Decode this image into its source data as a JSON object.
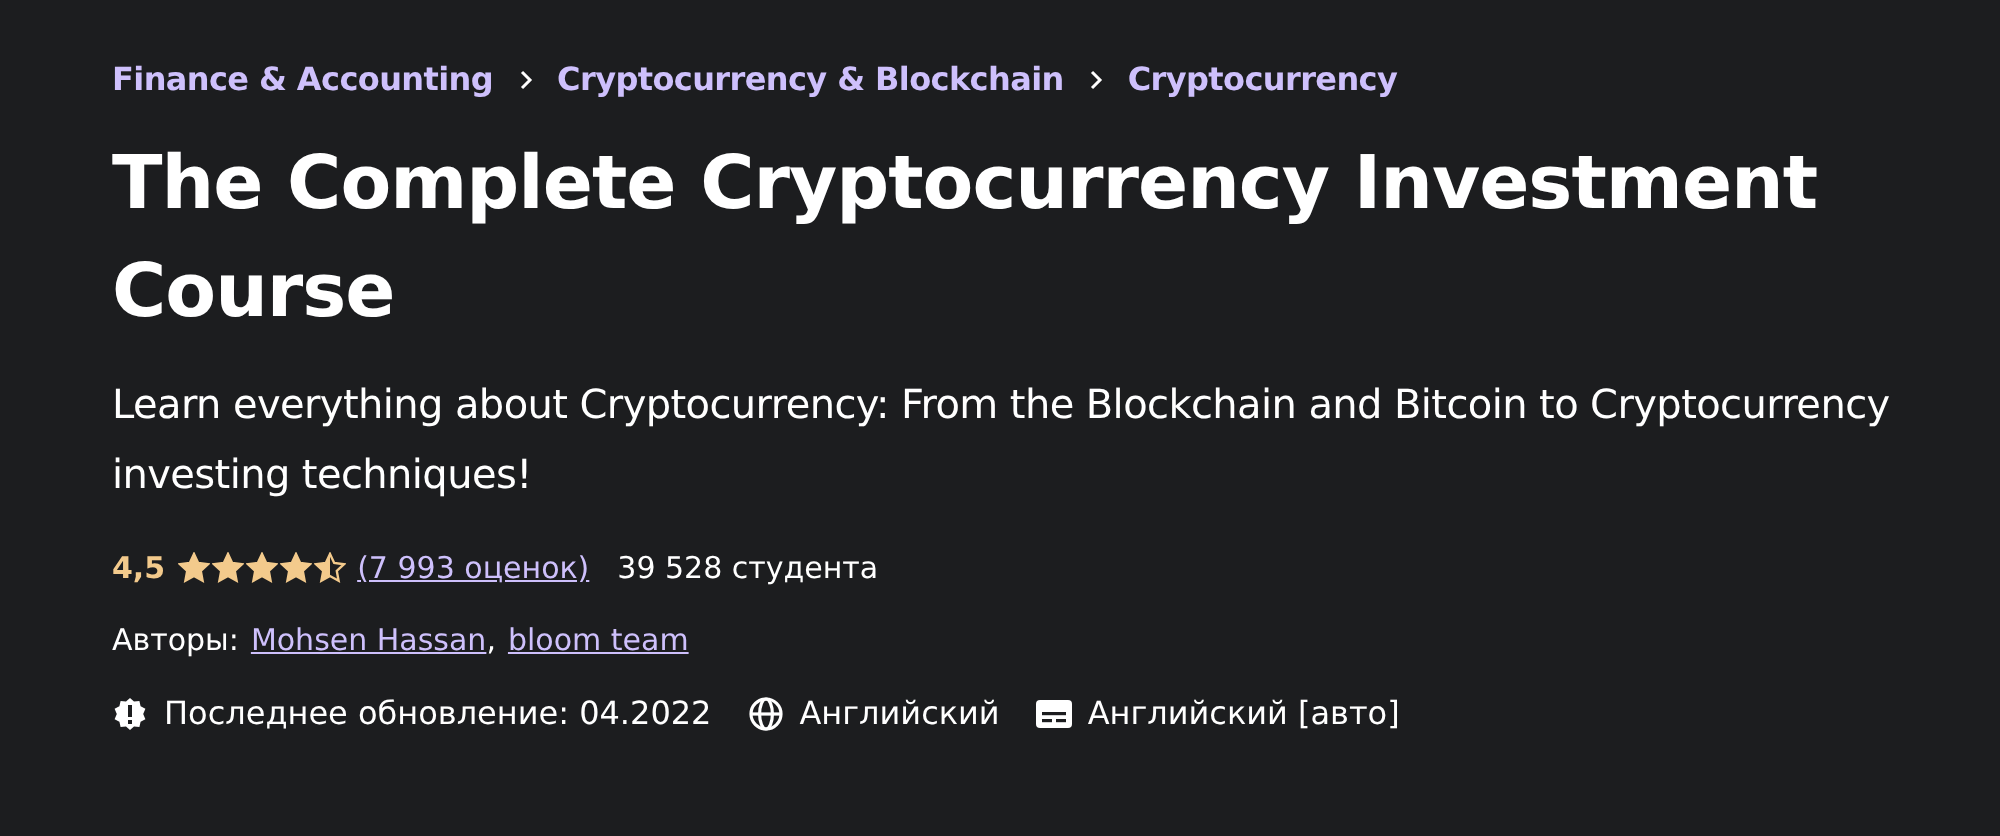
{
  "breadcrumbs": [
    "Finance & Accounting",
    "Cryptocurrency & Blockchain",
    "Cryptocurrency"
  ],
  "title": "The Complete Cryptocurrency Investment Course",
  "subtitle": "Learn everything about Cryptocurrency: From the Blockchain and Bitcoin to Cryptocurrency investing techniques!",
  "rating": {
    "score": "4,5",
    "stars": 4.5,
    "reviews": "(7 993 оценок)",
    "students": "39 528 студента"
  },
  "authors": {
    "label": "Авторы:",
    "separator": ",",
    "names": [
      "Mohsen Hassan",
      "bloom team"
    ]
  },
  "meta": [
    {
      "kind": "update",
      "text": "Последнее обновление: 04.2022"
    },
    {
      "kind": "language",
      "text": "Английский"
    },
    {
      "kind": "captions",
      "text": "Английский [авто]"
    }
  ]
}
